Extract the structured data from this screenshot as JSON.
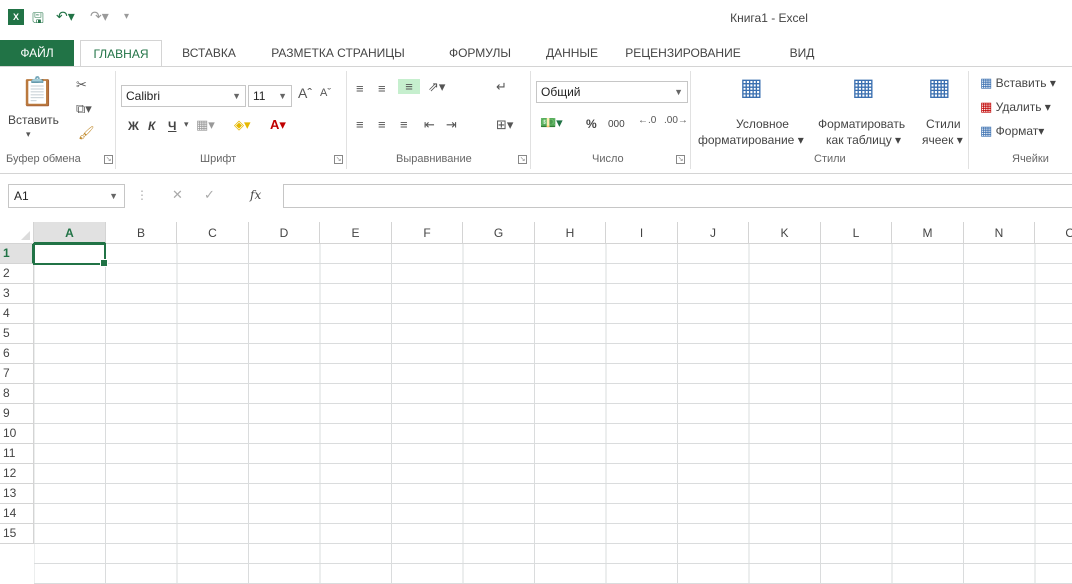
{
  "window": {
    "title": "Книга1 - Excel"
  },
  "quick_access": {
    "logo_text": "X",
    "save_icon": "save-icon",
    "undo_icon": "undo-icon",
    "redo_icon": "redo-icon"
  },
  "tabs": [
    {
      "label": "ФАЙЛ"
    },
    {
      "label": "ГЛАВНАЯ"
    },
    {
      "label": "ВСТАВКА"
    },
    {
      "label": "РАЗМЕТКА СТРАНИЦЫ"
    },
    {
      "label": "ФОРМУЛЫ"
    },
    {
      "label": "ДАННЫЕ"
    },
    {
      "label": "РЕЦЕНЗИРОВАНИЕ"
    },
    {
      "label": "ВИД"
    }
  ],
  "ribbon": {
    "clipboard": {
      "paste": "Вставить",
      "group": "Буфер обмена"
    },
    "font": {
      "name": "Calibri",
      "size": "11",
      "bold": "Ж",
      "italic": "К",
      "underline": "Ч",
      "group": "Шрифт"
    },
    "alignment": {
      "group": "Выравнивание"
    },
    "number": {
      "format": "Общий",
      "percent": "%",
      "thousands": "000",
      "group": "Число"
    },
    "styles": {
      "conditional_1": "Условное",
      "conditional_2": "форматирование",
      "as_table_1": "Форматировать",
      "as_table_2": "как таблицу",
      "cell_styles_1": "Стили",
      "cell_styles_2": "ячеек",
      "group": "Стили"
    },
    "cells": {
      "insert": "Вставить",
      "delete": "Удалить",
      "format": "Формат",
      "group": "Ячейки"
    }
  },
  "formula_bar": {
    "name_box": "A1",
    "fx": "fx",
    "value": ""
  },
  "grid": {
    "columns": [
      "A",
      "B",
      "C",
      "D",
      "E",
      "F",
      "G",
      "H",
      "I",
      "J",
      "K",
      "L",
      "M",
      "N",
      "O"
    ],
    "rows": [
      "1",
      "2",
      "3",
      "4",
      "5",
      "6",
      "7",
      "8",
      "9",
      "10",
      "11",
      "12",
      "13",
      "14",
      "15"
    ],
    "selected_cell": "A1"
  },
  "colors": {
    "accent": "#217346"
  }
}
